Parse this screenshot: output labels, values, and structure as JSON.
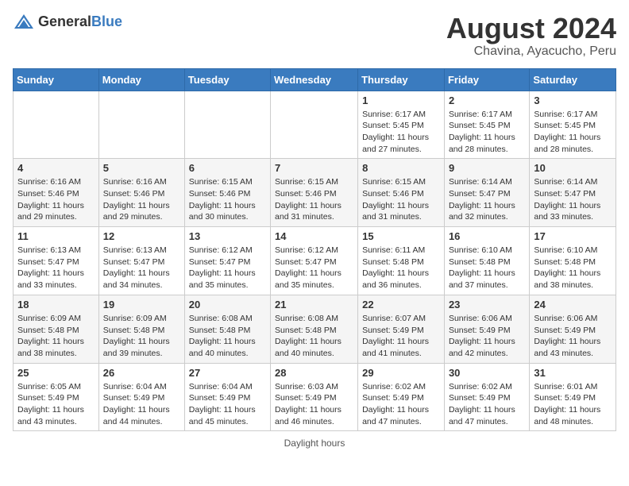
{
  "header": {
    "logo_general": "General",
    "logo_blue": "Blue",
    "month_year": "August 2024",
    "location": "Chavina, Ayacucho, Peru"
  },
  "weekdays": [
    "Sunday",
    "Monday",
    "Tuesday",
    "Wednesday",
    "Thursday",
    "Friday",
    "Saturday"
  ],
  "weeks": [
    [
      {
        "day": "",
        "info": ""
      },
      {
        "day": "",
        "info": ""
      },
      {
        "day": "",
        "info": ""
      },
      {
        "day": "",
        "info": ""
      },
      {
        "day": "1",
        "info": "Sunrise: 6:17 AM\nSunset: 5:45 PM\nDaylight: 11 hours and 27 minutes."
      },
      {
        "day": "2",
        "info": "Sunrise: 6:17 AM\nSunset: 5:45 PM\nDaylight: 11 hours and 28 minutes."
      },
      {
        "day": "3",
        "info": "Sunrise: 6:17 AM\nSunset: 5:45 PM\nDaylight: 11 hours and 28 minutes."
      }
    ],
    [
      {
        "day": "4",
        "info": "Sunrise: 6:16 AM\nSunset: 5:46 PM\nDaylight: 11 hours and 29 minutes."
      },
      {
        "day": "5",
        "info": "Sunrise: 6:16 AM\nSunset: 5:46 PM\nDaylight: 11 hours and 29 minutes."
      },
      {
        "day": "6",
        "info": "Sunrise: 6:15 AM\nSunset: 5:46 PM\nDaylight: 11 hours and 30 minutes."
      },
      {
        "day": "7",
        "info": "Sunrise: 6:15 AM\nSunset: 5:46 PM\nDaylight: 11 hours and 31 minutes."
      },
      {
        "day": "8",
        "info": "Sunrise: 6:15 AM\nSunset: 5:46 PM\nDaylight: 11 hours and 31 minutes."
      },
      {
        "day": "9",
        "info": "Sunrise: 6:14 AM\nSunset: 5:47 PM\nDaylight: 11 hours and 32 minutes."
      },
      {
        "day": "10",
        "info": "Sunrise: 6:14 AM\nSunset: 5:47 PM\nDaylight: 11 hours and 33 minutes."
      }
    ],
    [
      {
        "day": "11",
        "info": "Sunrise: 6:13 AM\nSunset: 5:47 PM\nDaylight: 11 hours and 33 minutes."
      },
      {
        "day": "12",
        "info": "Sunrise: 6:13 AM\nSunset: 5:47 PM\nDaylight: 11 hours and 34 minutes."
      },
      {
        "day": "13",
        "info": "Sunrise: 6:12 AM\nSunset: 5:47 PM\nDaylight: 11 hours and 35 minutes."
      },
      {
        "day": "14",
        "info": "Sunrise: 6:12 AM\nSunset: 5:47 PM\nDaylight: 11 hours and 35 minutes."
      },
      {
        "day": "15",
        "info": "Sunrise: 6:11 AM\nSunset: 5:48 PM\nDaylight: 11 hours and 36 minutes."
      },
      {
        "day": "16",
        "info": "Sunrise: 6:10 AM\nSunset: 5:48 PM\nDaylight: 11 hours and 37 minutes."
      },
      {
        "day": "17",
        "info": "Sunrise: 6:10 AM\nSunset: 5:48 PM\nDaylight: 11 hours and 38 minutes."
      }
    ],
    [
      {
        "day": "18",
        "info": "Sunrise: 6:09 AM\nSunset: 5:48 PM\nDaylight: 11 hours and 38 minutes."
      },
      {
        "day": "19",
        "info": "Sunrise: 6:09 AM\nSunset: 5:48 PM\nDaylight: 11 hours and 39 minutes."
      },
      {
        "day": "20",
        "info": "Sunrise: 6:08 AM\nSunset: 5:48 PM\nDaylight: 11 hours and 40 minutes."
      },
      {
        "day": "21",
        "info": "Sunrise: 6:08 AM\nSunset: 5:48 PM\nDaylight: 11 hours and 40 minutes."
      },
      {
        "day": "22",
        "info": "Sunrise: 6:07 AM\nSunset: 5:49 PM\nDaylight: 11 hours and 41 minutes."
      },
      {
        "day": "23",
        "info": "Sunrise: 6:06 AM\nSunset: 5:49 PM\nDaylight: 11 hours and 42 minutes."
      },
      {
        "day": "24",
        "info": "Sunrise: 6:06 AM\nSunset: 5:49 PM\nDaylight: 11 hours and 43 minutes."
      }
    ],
    [
      {
        "day": "25",
        "info": "Sunrise: 6:05 AM\nSunset: 5:49 PM\nDaylight: 11 hours and 43 minutes."
      },
      {
        "day": "26",
        "info": "Sunrise: 6:04 AM\nSunset: 5:49 PM\nDaylight: 11 hours and 44 minutes."
      },
      {
        "day": "27",
        "info": "Sunrise: 6:04 AM\nSunset: 5:49 PM\nDaylight: 11 hours and 45 minutes."
      },
      {
        "day": "28",
        "info": "Sunrise: 6:03 AM\nSunset: 5:49 PM\nDaylight: 11 hours and 46 minutes."
      },
      {
        "day": "29",
        "info": "Sunrise: 6:02 AM\nSunset: 5:49 PM\nDaylight: 11 hours and 47 minutes."
      },
      {
        "day": "30",
        "info": "Sunrise: 6:02 AM\nSunset: 5:49 PM\nDaylight: 11 hours and 47 minutes."
      },
      {
        "day": "31",
        "info": "Sunrise: 6:01 AM\nSunset: 5:49 PM\nDaylight: 11 hours and 48 minutes."
      }
    ]
  ],
  "footer": {
    "note": "Daylight hours"
  }
}
